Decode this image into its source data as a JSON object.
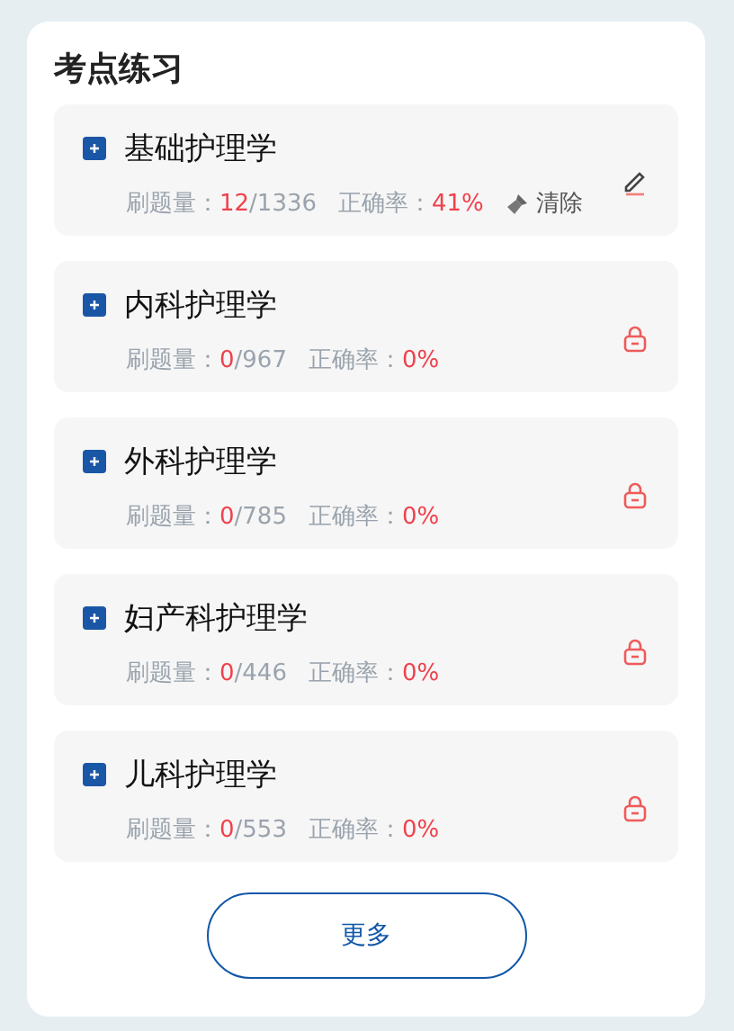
{
  "title": "考点练习",
  "items": [
    {
      "name": "基础护理学",
      "kind": "edit",
      "count_label": "刷题量：",
      "done": "12",
      "total": "/1336",
      "rate_label": "正确率：",
      "rate": "41%",
      "clear_label": "清除"
    },
    {
      "name": "内科护理学",
      "kind": "locked",
      "count_label": "刷题量：",
      "done": "0",
      "total": "/967",
      "rate_label": "正确率：",
      "rate": "0%"
    },
    {
      "name": "外科护理学",
      "kind": "locked",
      "count_label": "刷题量：",
      "done": "0",
      "total": "/785",
      "rate_label": "正确率：",
      "rate": "0%"
    },
    {
      "name": "妇产科护理学",
      "kind": "locked",
      "count_label": "刷题量：",
      "done": "0",
      "total": "/446",
      "rate_label": "正确率：",
      "rate": "0%"
    },
    {
      "name": "儿科护理学",
      "kind": "locked",
      "count_label": "刷题量：",
      "done": "0",
      "total": "/553",
      "rate_label": "正确率：",
      "rate": "0%"
    }
  ],
  "more_button": "更多"
}
